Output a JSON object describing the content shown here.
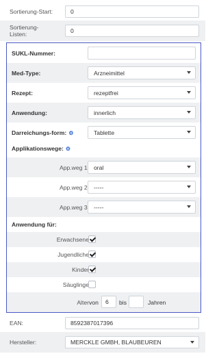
{
  "top": {
    "sort_start": {
      "label": "Sortierung-Start:",
      "value": "0"
    },
    "sort_lists": {
      "label": "Sortierung-Listen:",
      "value": "0"
    }
  },
  "panel": {
    "sukl": {
      "label": "SUKL-Nummer:",
      "value": ""
    },
    "med_type": {
      "label": "Med-Type:",
      "value": "Arzneimittel"
    },
    "rezept": {
      "label": "Rezept:",
      "value": "rezeptfrei"
    },
    "anwendung": {
      "label": "Anwendung:",
      "value": "innerlich"
    },
    "darreichungsform": {
      "label": "Darreichungs-form:",
      "value": "Tablette"
    },
    "applikationswege": {
      "label": "Applikationswege:"
    },
    "app1": {
      "label": "App.weg 1:",
      "value": "oral"
    },
    "app2": {
      "label": "App.weg 2:",
      "value": "-----"
    },
    "app3": {
      "label": "App.weg 3:",
      "value": "-----"
    },
    "anwendung_fuer": {
      "label": "Anwendung für:"
    },
    "erwachsene": {
      "label": "Erwachsene",
      "checked": true
    },
    "jugendliche": {
      "label": "Jugendliche",
      "checked": true
    },
    "kinder": {
      "label": "Kinder",
      "checked": true
    },
    "sauglinge": {
      "label": "Säuglinge",
      "checked": false
    },
    "alter": {
      "label": "Alter",
      "von": "von",
      "von_value": "6",
      "bis": "bis",
      "bis_value": "",
      "jahren": "Jahren"
    }
  },
  "bottom": {
    "ean": {
      "label": "EAN:",
      "value": "8592387017396"
    },
    "hersteller": {
      "label": "Hersteller:",
      "value": "MERCKLE GMBH, BLAUBEUREN"
    }
  },
  "colors": {
    "panel_border": "#4a57c4",
    "gear": "#3b6fd1",
    "row_shade": "#eef0f2"
  },
  "icons": {
    "gear": "cogs-icon",
    "caret": "chevron-down-icon",
    "check": "check-icon"
  }
}
